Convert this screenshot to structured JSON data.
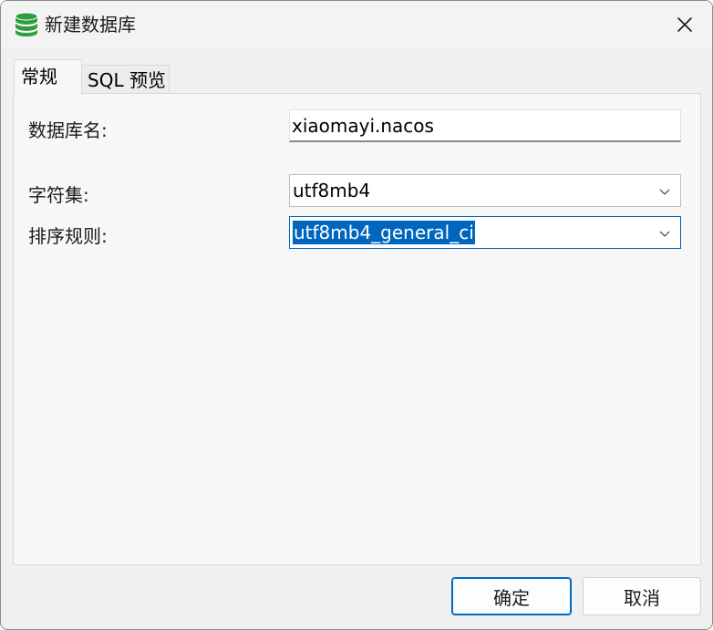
{
  "window": {
    "title": "新建数据库"
  },
  "tabs": [
    {
      "label": "常规",
      "active": true
    },
    {
      "label": "SQL 预览",
      "active": false
    }
  ],
  "form": {
    "name_label": "数据库名:",
    "name_value": "xiaomayi.nacos",
    "charset_label": "字符集:",
    "charset_value": "utf8mb4",
    "collation_label": "排序规则:",
    "collation_value": "utf8mb4_general_ci"
  },
  "buttons": {
    "ok": "确定",
    "cancel": "取消"
  },
  "icons": {
    "app": "database-icon",
    "close": "close-icon",
    "dropdown": "chevron-down-icon"
  },
  "colors": {
    "accent": "#0067c0",
    "db_icon": "#2e9e3e"
  }
}
